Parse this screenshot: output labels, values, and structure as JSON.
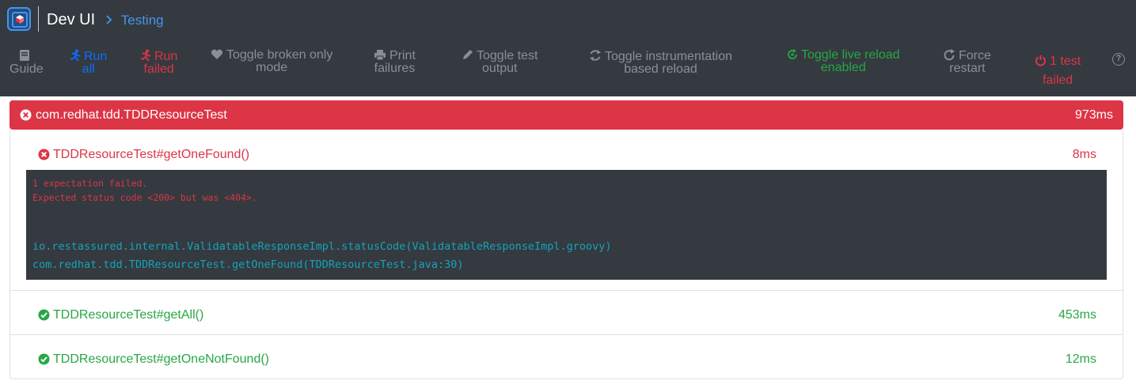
{
  "app": {
    "title": "Dev UI",
    "breadcrumb": "Testing"
  },
  "toolbar": {
    "guide": {
      "label": "Guide"
    },
    "run_all": {
      "line1": "Run",
      "line2": "all"
    },
    "run_failed": {
      "line1": "Run",
      "line2": "failed"
    },
    "toggle_broken": {
      "line1": "Toggle broken only",
      "line2": "mode"
    },
    "print_failures": {
      "line1": "Print",
      "line2": "failures"
    },
    "toggle_output": {
      "line1": "Toggle test",
      "line2": "output"
    },
    "toggle_instrumentation": {
      "line1": "Toggle instrumentation",
      "line2": "based reload"
    },
    "live_reload": {
      "line1": "Toggle live reload",
      "line2": "enabled"
    },
    "force_restart": {
      "line1": "Force",
      "line2": "restart"
    },
    "test_status": {
      "line1": "1 test",
      "line2": "failed"
    }
  },
  "suite": {
    "name": "com.redhat.tdd.TDDResourceTest",
    "time": "973ms",
    "status": "failed",
    "tests": [
      {
        "name": "TDDResourceTest#getOneFound()",
        "time": "8ms",
        "status": "failed",
        "error_lines": [
          "1 expectation failed.",
          "Expected status code <200> but was <404>."
        ],
        "stack_lines": [
          "io.restassured.internal.ValidatableResponseImpl.statusCode(ValidatableResponseImpl.groovy)",
          "com.redhat.tdd.TDDResourceTest.getOneFound(TDDResourceTest.java:30)"
        ]
      },
      {
        "name": "TDDResourceTest#getAll()",
        "time": "453ms",
        "status": "passed"
      },
      {
        "name": "TDDResourceTest#getOneNotFound()",
        "time": "12ms",
        "status": "passed"
      }
    ]
  },
  "colors": {
    "navbar": "#343a40",
    "accent": "#4695eb",
    "failed": "#dc3545",
    "passed": "#28a745",
    "muted": "#8a8f95",
    "stacktrace": "#17a2b8"
  },
  "icons": [
    "quarkus-logo-icon",
    "chevron-right-icon",
    "book-icon",
    "running-icon",
    "heart-icon",
    "print-icon",
    "pen-icon",
    "sync-icon",
    "live-reload-icon",
    "redo-icon",
    "power-icon",
    "question-circle-icon",
    "x-circle-icon",
    "check-circle-icon"
  ]
}
